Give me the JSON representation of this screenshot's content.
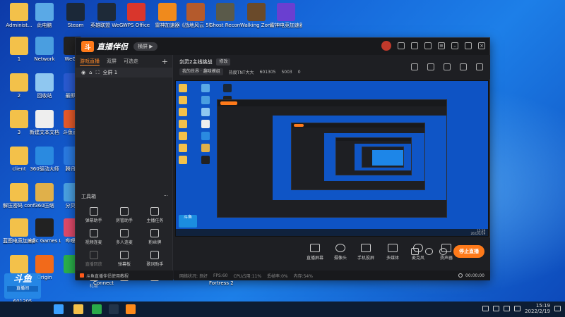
{
  "desktop_icons": [
    {
      "label": "Administ...",
      "icon": "user-folder-icon",
      "color": "#f3c14a",
      "col": 0,
      "row": 0
    },
    {
      "label": "此电脑",
      "icon": "computer-icon",
      "color": "#5aa9e6",
      "col": 1,
      "row": 0
    },
    {
      "label": "Steam",
      "icon": "steam-icon",
      "color": "#1b2838",
      "col": 2,
      "row": 0
    },
    {
      "label": "英雄联盟 WeGame版",
      "icon": "lol-icon",
      "color": "#1e2a38",
      "col": 3,
      "row": 0
    },
    {
      "label": "WPS Office",
      "icon": "wps-icon",
      "color": "#d9362c",
      "col": 4,
      "row": 0
    },
    {
      "label": "雷神加速器",
      "icon": "accelerator-icon",
      "color": "#f08a1c",
      "col": 5,
      "row": 0
    },
    {
      "label": "《战地风云 5》",
      "icon": "battlefield-icon",
      "color": "#b45a2c",
      "col": 6,
      "row": 0
    },
    {
      "label": "Ghost Recon® ...",
      "icon": "ghost-recon-icon",
      "color": "#5a5a4a",
      "col": 7,
      "row": 0
    },
    {
      "label": "Walking Zombie 2",
      "icon": "zombie-icon",
      "color": "#6a4a2a",
      "col": 8,
      "row": 0
    },
    {
      "label": "雷神电竞加速器",
      "icon": "esports-accelerator-icon",
      "color": "#6a3fd0",
      "col": 9,
      "row": 0
    },
    {
      "label": "1",
      "icon": "folder-icon",
      "color": "#f3c14a",
      "col": 0,
      "row": 1
    },
    {
      "label": "Network",
      "icon": "network-icon",
      "color": "#4a9ee0",
      "col": 1,
      "row": 1
    },
    {
      "label": "WeG...",
      "icon": "wegame-icon",
      "color": "#222222",
      "col": 2,
      "row": 1
    },
    {
      "label": "2",
      "icon": "folder-icon",
      "color": "#f3c14a",
      "col": 0,
      "row": 2
    },
    {
      "label": "回收站",
      "icon": "recycle-bin-icon",
      "color": "#8fc7f0",
      "col": 1,
      "row": 2
    },
    {
      "label": "最即...",
      "icon": "app-icon",
      "color": "#2a5ad0",
      "col": 2,
      "row": 2
    },
    {
      "label": "3",
      "icon": "folder-icon",
      "color": "#f3c14a",
      "col": 0,
      "row": 3
    },
    {
      "label": "新建文本文档",
      "icon": "text-file-icon",
      "color": "#eeeeee",
      "col": 1,
      "row": 3
    },
    {
      "label": "斗鱼直...",
      "icon": "douyu-icon",
      "color": "#e65a2a",
      "col": 2,
      "row": 3
    },
    {
      "label": "client",
      "icon": "folder-icon",
      "color": "#f3c14a",
      "col": 0,
      "row": 4
    },
    {
      "label": "360驱动大师",
      "icon": "driver-icon",
      "color": "#2a8ae0",
      "col": 1,
      "row": 4
    },
    {
      "label": "腾讯...",
      "icon": "tencent-icon",
      "color": "#2a7ae0",
      "col": 2,
      "row": 4
    },
    {
      "label": "解压密码 config文...",
      "icon": "config-file-icon",
      "color": "#f3c14a",
      "col": 0,
      "row": 5
    },
    {
      "label": "360压缩",
      "icon": "archive-icon",
      "color": "#e0b04a",
      "col": 1,
      "row": 5
    },
    {
      "label": "分贝...",
      "icon": "app-icon",
      "color": "#4aa0e0",
      "col": 2,
      "row": 5
    },
    {
      "label": "蓝图电竞加速器",
      "icon": "folder-icon",
      "color": "#f3c14a",
      "col": 0,
      "row": 6
    },
    {
      "label": "Epic Games Launcher",
      "icon": "epic-games-icon",
      "color": "#222222",
      "col": 1,
      "row": 6
    },
    {
      "label": "哔哩...",
      "icon": "bilibili-icon",
      "color": "#e04a6a",
      "col": 2,
      "row": 6
    },
    {
      "label": "",
      "icon": "folder-icon",
      "color": "#f3c14a",
      "col": 0,
      "row": 7
    },
    {
      "label": "Origin",
      "icon": "origin-icon",
      "color": "#f26a1a",
      "col": 1,
      "row": 7
    },
    {
      "label": "",
      "icon": "wechat-icon",
      "color": "#2ab04a",
      "col": 2,
      "row": 7
    }
  ],
  "window": {
    "logo_mark": "斗",
    "app_name": "直播伴侣",
    "mode_pill": "横屏 ▶",
    "scene_tabs": [
      "游戏直播",
      "双屏",
      "可选走"
    ],
    "scene_add": "+",
    "scene_item": "全屏 1",
    "tools_title": "工具箱",
    "tools_more": "···",
    "tools": [
      {
        "label": "弹幕助手",
        "icon": "danmaku-icon",
        "dim": false
      },
      {
        "label": "房管助手",
        "icon": "room-manager-icon",
        "dim": false
      },
      {
        "label": "主播任务",
        "icon": "task-icon",
        "dim": false
      },
      {
        "label": "视频连麦",
        "icon": "video-link-icon",
        "dim": false
      },
      {
        "label": "多人连麦",
        "icon": "multi-link-icon",
        "dim": false
      },
      {
        "label": "粉丝牌",
        "icon": "fan-badge-icon",
        "dim": false
      },
      {
        "label": "直播回放",
        "icon": "replay-icon",
        "dim": true
      },
      {
        "label": "弹幕板",
        "icon": "danmaku-board-icon",
        "dim": false
      },
      {
        "label": "歌词助手",
        "icon": "lyrics-icon",
        "dim": false
      },
      {
        "label": "礼物",
        "icon": "gift-icon",
        "dim": false
      },
      {
        "label": "",
        "icon": "more-icon",
        "dim": false
      },
      {
        "label": "",
        "icon": "car-icon",
        "dim": false
      }
    ],
    "notice": "斗鱼直播伴侣使用教程",
    "stream_title": "剑灵2主线挑战",
    "edit_label": "修改",
    "room_chip": "我的世界 · 趣味模组",
    "streamer": "热度TNT大大",
    "room_id": "601305",
    "fans_count": "5003",
    "online_count": "0",
    "bottom_tools": [
      "直播屏幕",
      "摄像头",
      "手机投屏",
      "多媒体",
      "麦克风",
      "扬声器"
    ],
    "start_button": "停止直播",
    "status": {
      "net": "网络状况: 良好",
      "fps": "FPS:60",
      "cpu": "CPU占用:11%",
      "drop": "丢帧率:0%",
      "mem": "内存:54%",
      "timer": "00:00:00"
    }
  },
  "under_labels": [
    "Connect",
    "Fortress 2"
  ],
  "douyu_badge": {
    "top": "斗鱼",
    "tag": "直播间",
    "id": "601305"
  },
  "taskbar": {
    "time": "15:19",
    "date": "2022/2/19",
    "pinned": [
      {
        "icon": "windows-start-icon",
        "color": "#3aa0ff"
      },
      {
        "icon": "folder-icon",
        "color": "#f3c14a"
      },
      {
        "icon": "green-app-icon",
        "color": "#2aaa4a"
      },
      {
        "icon": "steam-icon",
        "color": "#22344a"
      },
      {
        "icon": "douyu-live-icon",
        "color": "#ff8a1a"
      }
    ]
  },
  "preview": {
    "time": "15:19",
    "date": "2022/2/19",
    "douyu_label": "斗鱼"
  },
  "colors": {
    "accent": "#ff7a1a",
    "panel": "#1e1f23",
    "desktop": "#1565d8"
  }
}
